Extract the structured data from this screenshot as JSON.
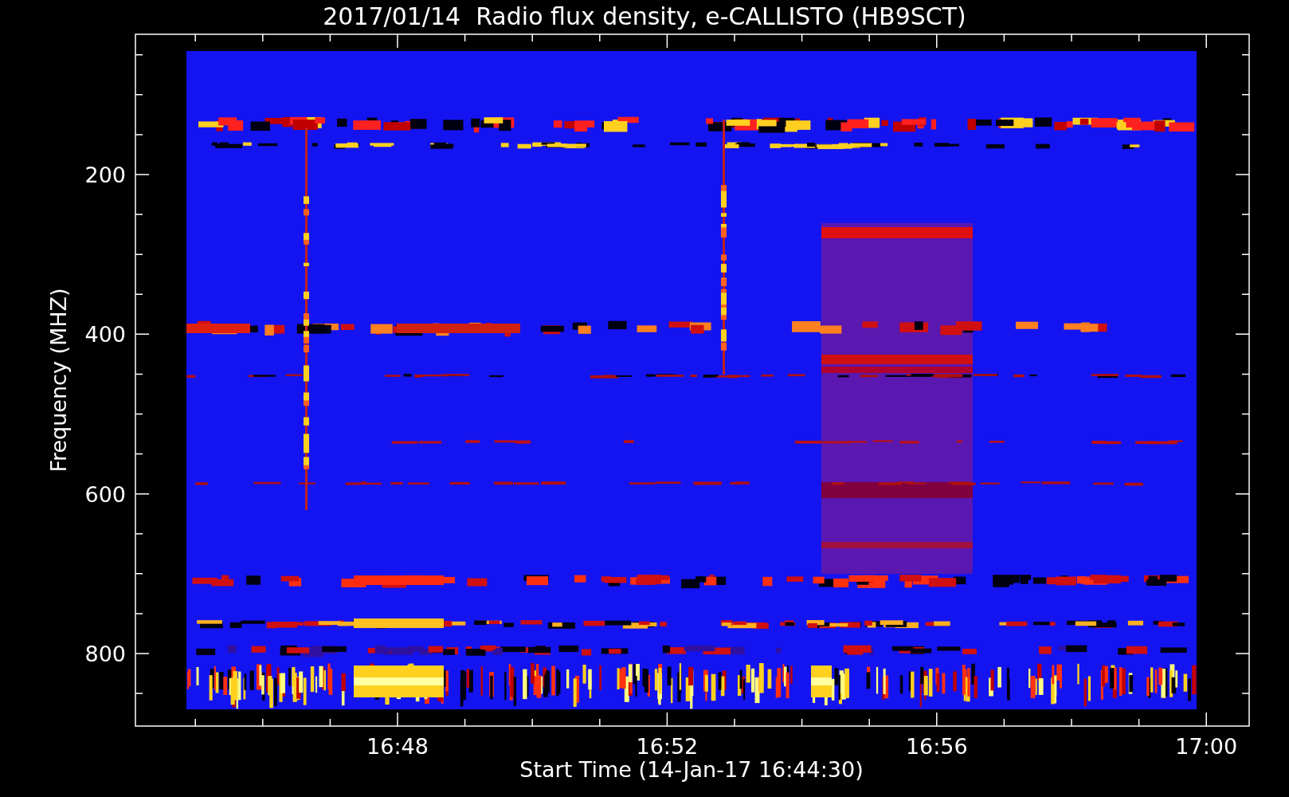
{
  "title": "2017/01/14  Radio flux density, e-CALLISTO (HB9SCT)",
  "y_axis": {
    "label": "Frequency (MHZ)",
    "tick_labels": [
      "200",
      "400",
      "600",
      "800"
    ]
  },
  "x_axis": {
    "label": "Start Time (14-Jan-17 16:44:30)",
    "tick_labels": [
      "16:48",
      "16:52",
      "16:56",
      "17:00"
    ]
  }
}
